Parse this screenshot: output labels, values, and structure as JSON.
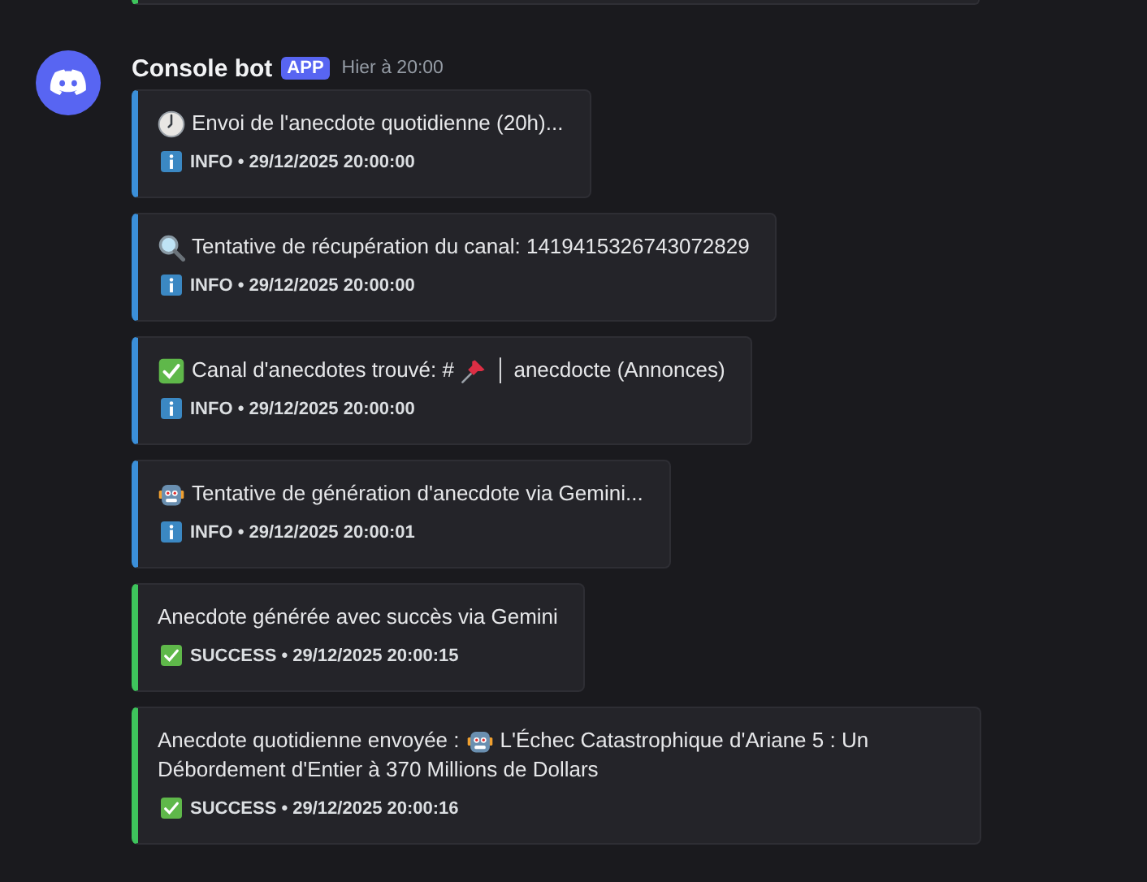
{
  "previous_embed": {
    "kind": "success"
  },
  "message": {
    "author": "Console bot",
    "badge": "APP",
    "timestamp": "Hier à 20:00",
    "embeds": [
      {
        "kind": "info",
        "title": [
          {
            "kind": "clock"
          },
          {
            "kind": "text",
            "text": "Envoi de l'anecdote quotidienne (20h)..."
          }
        ],
        "footer": "INFO • 29/12/2025 20:00:00"
      },
      {
        "kind": "info",
        "title": [
          {
            "kind": "magnifier"
          },
          {
            "kind": "text",
            "text": "Tentative de récupération du canal: 1419415326743072829"
          }
        ],
        "footer": "INFO • 29/12/2025 20:00:00"
      },
      {
        "kind": "info",
        "title": [
          {
            "kind": "check"
          },
          {
            "kind": "text",
            "text": "Canal d'anecdotes trouvé: #"
          },
          {
            "kind": "pin"
          },
          {
            "kind": "text",
            "text": "│ anecdocte (Annonces)"
          }
        ],
        "footer": "INFO • 29/12/2025 20:00:00"
      },
      {
        "kind": "info",
        "title": [
          {
            "kind": "robot"
          },
          {
            "kind": "text",
            "text": "Tentative de génération d'anecdote via Gemini..."
          }
        ],
        "footer": "INFO • 29/12/2025 20:00:01"
      },
      {
        "kind": "success",
        "title": [
          {
            "kind": "text",
            "text": "Anecdote générée avec succès via Gemini"
          }
        ],
        "footer": "SUCCESS • 29/12/2025 20:00:15"
      },
      {
        "kind": "success",
        "title": [
          {
            "kind": "text",
            "text": "Anecdote quotidienne envoyée :"
          },
          {
            "kind": "robot"
          },
          {
            "kind": "text",
            "text": "L'Échec Catastrophique d'Ariane 5 : Un"
          },
          {
            "kind": "text",
            "text": "Débordement d'Entier à 370 Millions de Dollars"
          }
        ],
        "footer": "SUCCESS • 29/12/2025 20:00:16"
      }
    ]
  }
}
